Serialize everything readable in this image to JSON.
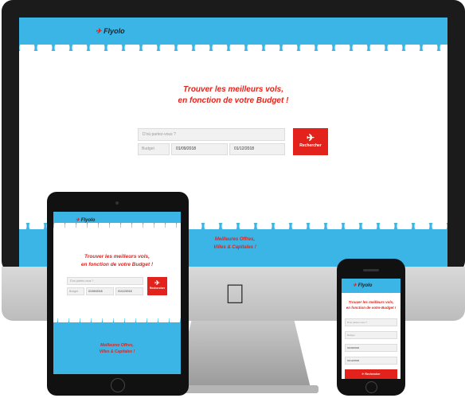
{
  "brand": {
    "name": "Flyolo",
    "accent": "#e3231b",
    "sky": "#3ab5e6"
  },
  "hero": {
    "line1": "Trouver les meilleurs vols,",
    "line2": "en fonction de votre Budget !"
  },
  "search": {
    "destination_placeholder": "D'où partez-vous ?",
    "budget_placeholder": "Budget",
    "date_from": "01/09/2018",
    "date_to": "01/12/2018",
    "button_label": "Rechercher"
  },
  "promo": {
    "line1": "Meilleures Offres,",
    "line2": "Villes & Capitales !"
  },
  "icons": {
    "plane": "plane-icon",
    "apple": "apple-logo-icon"
  }
}
